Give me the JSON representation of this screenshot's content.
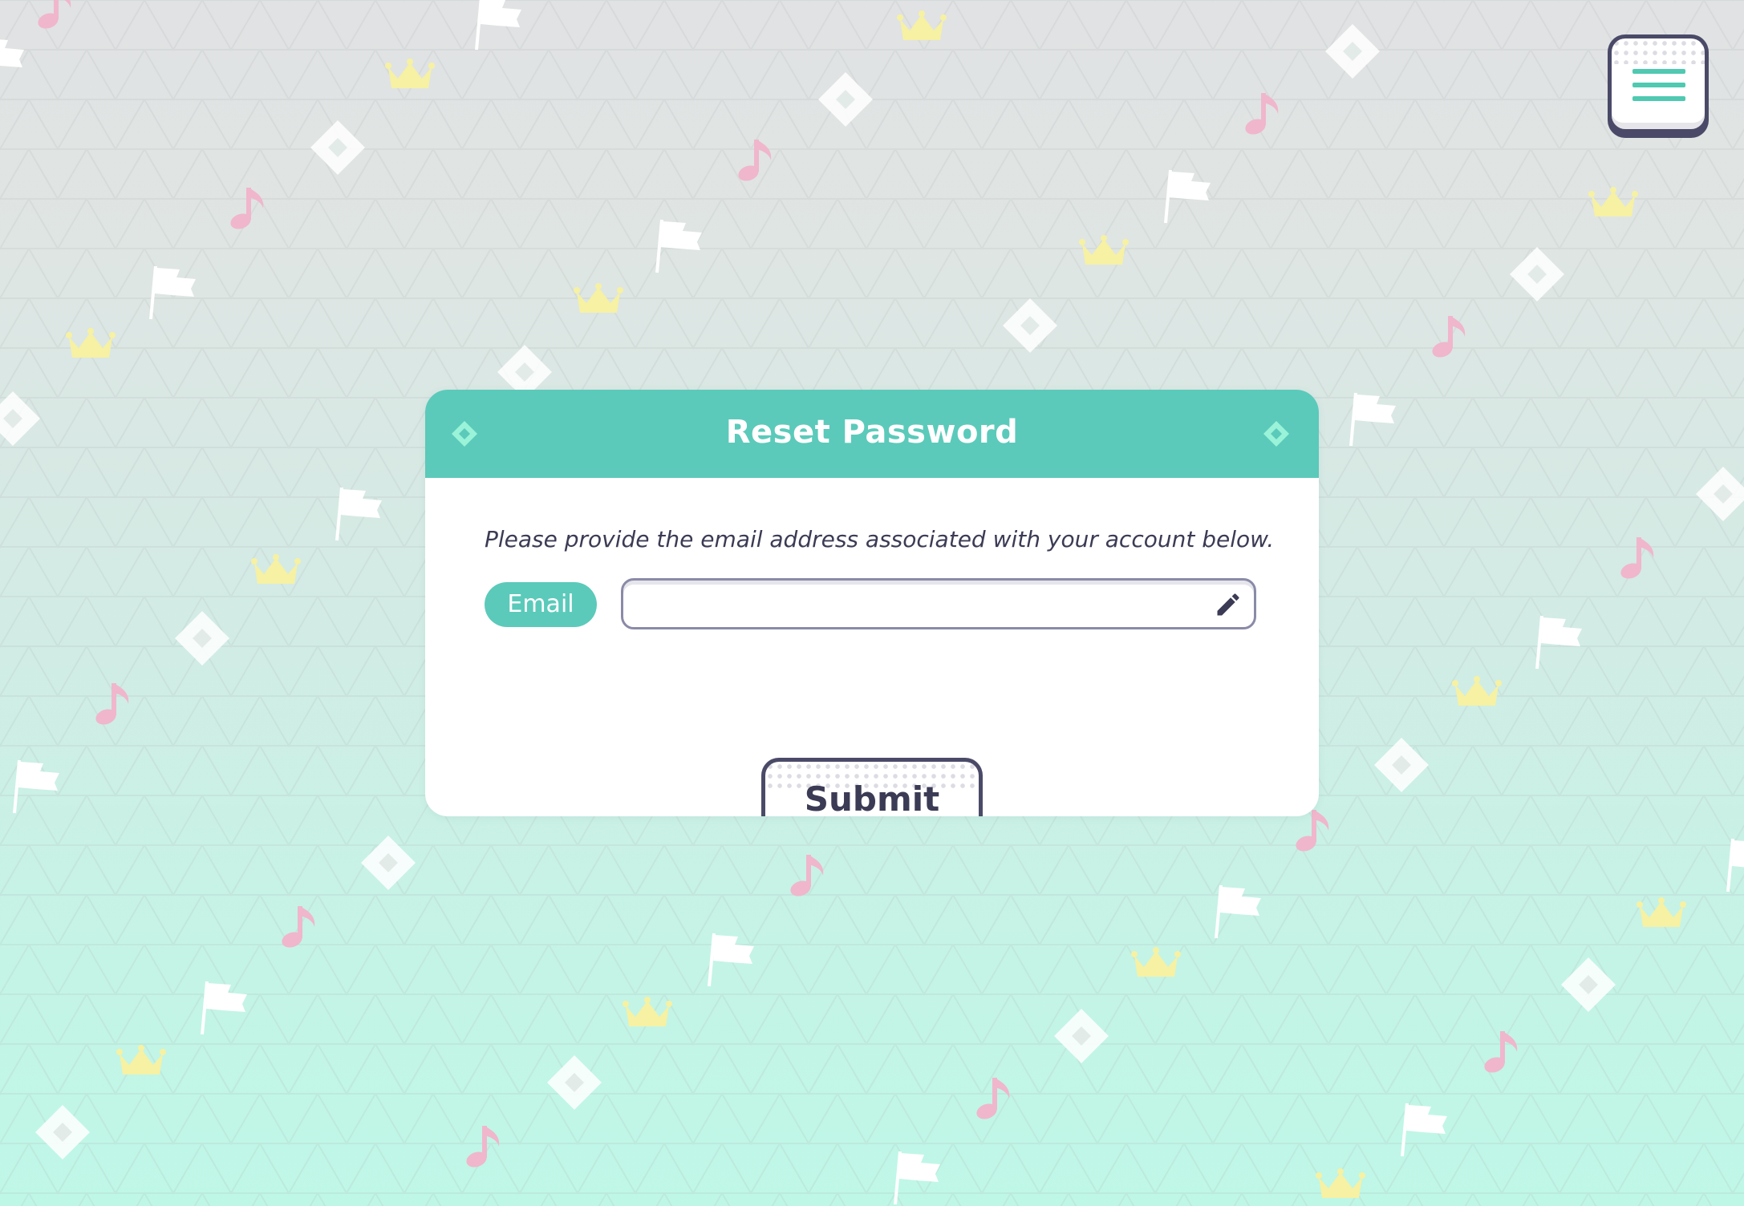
{
  "page": {
    "background_top": "#e1e2e3",
    "background_bottom": "#bff7e7"
  },
  "menu": {
    "icon": "hamburger-menu-icon"
  },
  "dialog": {
    "title": "Reset Password",
    "accent_color": "#5bcaba",
    "instruction": "Please provide the email address associated with your account below.",
    "email_label": "Email",
    "email_value": "",
    "email_placeholder": "",
    "email_field_icon": "pencil-icon",
    "submit_label": "Submit"
  },
  "decorations": {
    "icons": [
      "music-note-icon",
      "flag-icon",
      "crown-icon",
      "diamond-icon"
    ],
    "colors": {
      "music_note": "#f0b6cc",
      "flag": "#ffffff",
      "crown": "#f6f1a3",
      "diamond": "#ffffff"
    }
  }
}
